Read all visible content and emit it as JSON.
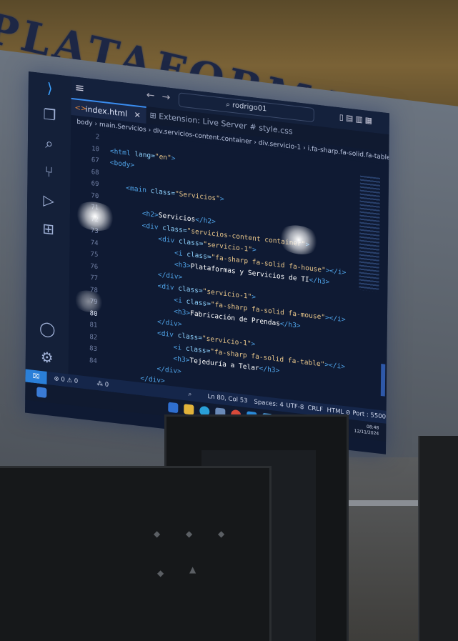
{
  "banner": {
    "text": "PLATAFORMAS Y SERVICIOS"
  },
  "titlebar": {
    "search_text": "rodrigo01"
  },
  "tabs": [
    {
      "label": "index.html",
      "close": "✕"
    },
    {
      "label": "Extension: Live Server"
    },
    {
      "label": "style.css"
    }
  ],
  "breadcrumb": {
    "items": [
      "body",
      "main.Servicios",
      "div.servicios-content.container",
      "div.servicio-1",
      "i.fa-sharp.fa-solid.fa-table"
    ],
    "separator": "›"
  },
  "editor": {
    "line_numbers": [
      "2",
      "10",
      "67",
      "68",
      "69",
      "70",
      "71",
      "72",
      "73",
      "74",
      "75",
      "76",
      "77",
      "78",
      "79",
      "80",
      "81",
      "82",
      "83",
      "84"
    ],
    "current_line": "80",
    "lines": [
      {
        "pre": "",
        "tag_open": "<html ",
        "attr": "lang=",
        "str": "\"en\"",
        "tag_close": ">",
        "text": ""
      },
      {
        "pre": "",
        "tag_open": "<body>",
        "attr": "",
        "str": "",
        "tag_close": "",
        "text": ""
      },
      {
        "pre": "",
        "tag_open": "",
        "attr": "",
        "str": "",
        "tag_close": "",
        "text": ""
      },
      {
        "pre": "    ",
        "tag_open": "<main ",
        "attr": "class=",
        "str": "\"Servicios\"",
        "tag_close": ">",
        "text": ""
      },
      {
        "pre": "",
        "tag_open": "",
        "attr": "",
        "str": "",
        "tag_close": "",
        "text": ""
      },
      {
        "pre": "        ",
        "tag_open": "<h2>",
        "attr": "",
        "str": "",
        "tag_close": "</h2>",
        "text": "Servicios"
      },
      {
        "pre": "        ",
        "tag_open": "<div ",
        "attr": "class=",
        "str": "\"servicios-content container\"",
        "tag_close": ">",
        "text": ""
      },
      {
        "pre": "            ",
        "tag_open": "<div ",
        "attr": "class=",
        "str": "\"servicio-1\"",
        "tag_close": ">",
        "text": ""
      },
      {
        "pre": "                ",
        "tag_open": "<i ",
        "attr": "class=",
        "str": "\"fa-sharp fa-solid fa-house\"",
        "tag_close": "></i>",
        "text": ""
      },
      {
        "pre": "                ",
        "tag_open": "<h3>",
        "attr": "",
        "str": "",
        "tag_close": "</h3>",
        "text": "Plataformas y Servicios de TI"
      },
      {
        "pre": "            ",
        "tag_open": "</div>",
        "attr": "",
        "str": "",
        "tag_close": "",
        "text": ""
      },
      {
        "pre": "            ",
        "tag_open": "<div ",
        "attr": "class=",
        "str": "\"servicio-1\"",
        "tag_close": ">",
        "text": ""
      },
      {
        "pre": "                ",
        "tag_open": "<i ",
        "attr": "class=",
        "str": "\"fa-sharp fa-solid fa-mouse\"",
        "tag_close": "></i>",
        "text": ""
      },
      {
        "pre": "                ",
        "tag_open": "<h3>",
        "attr": "",
        "str": "",
        "tag_close": "</h3>",
        "text": "Fabricación de Prendas"
      },
      {
        "pre": "            ",
        "tag_open": "</div>",
        "attr": "",
        "str": "",
        "tag_close": "",
        "text": ""
      },
      {
        "pre": "            ",
        "tag_open": "<div ",
        "attr": "class=",
        "str": "\"servicio-1\"",
        "tag_close": ">",
        "text": ""
      },
      {
        "pre": "                ",
        "tag_open": "<i ",
        "attr": "class=",
        "str": "\"fa-sharp fa-solid fa-table\"",
        "tag_close": "></i>",
        "text": ""
      },
      {
        "pre": "                ",
        "tag_open": "<h3>",
        "attr": "",
        "str": "",
        "tag_close": "</h3>",
        "text": "Tejeduría a Telar"
      },
      {
        "pre": "            ",
        "tag_open": "</div>",
        "attr": "",
        "str": "",
        "tag_close": "",
        "text": ""
      },
      {
        "pre": "        ",
        "tag_open": "</div>",
        "attr": "",
        "str": "",
        "tag_close": "",
        "text": ""
      }
    ]
  },
  "statusbar": {
    "errors": "⊗ 0 ⚠ 0",
    "ports": "⁂ 0",
    "position": "Ln 80, Col 53",
    "spaces": "Spaces: 4",
    "encoding": "UTF-8",
    "eol": "CRLF",
    "language": "HTML",
    "port": "⊘ Port : 5500"
  },
  "taskbar": {
    "time": "08:48",
    "date": "12/11/2024"
  },
  "colors": {
    "accent": "#3a8df0",
    "editor_bg": "#0f1a33",
    "statusbar": "#15264a"
  }
}
